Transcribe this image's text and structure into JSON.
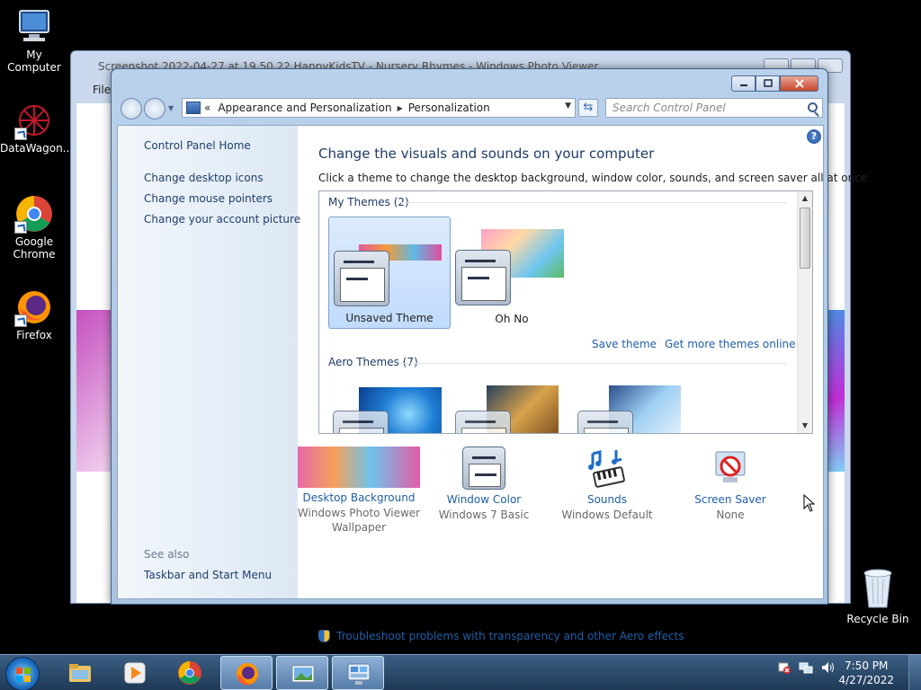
{
  "desktop": {
    "icons": [
      {
        "label": "My Computer",
        "icon": "computer-icon"
      },
      {
        "label": "DataWagon...",
        "icon": "datawagon-icon"
      },
      {
        "label": "Google Chrome",
        "icon": "chrome-icon"
      },
      {
        "label": "Firefox",
        "icon": "firefox-icon"
      }
    ],
    "recycle_bin": "Recycle Bin"
  },
  "photo_viewer": {
    "title": "Screenshot 2022-04-27 at 19.50.22 HappyKidsTV - Nursery Rhymes - Windows Photo Viewer",
    "menu_file": "File"
  },
  "control_panel": {
    "address": {
      "root_chevron": "«",
      "crumb1": "Appearance and Personalization",
      "arrow": "▶",
      "crumb2": "Personalization"
    },
    "search_placeholder": "Search Control Panel",
    "left_pane": {
      "home": "Control Panel Home",
      "links": [
        "Change desktop icons",
        "Change mouse pointers",
        "Change your account picture"
      ],
      "see_also": "See also",
      "see_also_link": "Taskbar and Start Menu"
    },
    "heading": "Change the visuals and sounds on your computer",
    "description": "Click a theme to change the desktop background, window color, sounds, and screen saver all at once.",
    "my_themes_header": "My Themes (2)",
    "my_themes": [
      {
        "label": "Unsaved Theme",
        "selected": true
      },
      {
        "label": "Oh No",
        "selected": false
      }
    ],
    "save_theme": "Save theme",
    "get_more": "Get more themes online",
    "aero_header": "Aero Themes (7)",
    "bottom_items": [
      {
        "link": "Desktop Background",
        "sub": "Windows Photo Viewer Wallpaper",
        "icon": "desktop-background-icon"
      },
      {
        "link": "Window Color",
        "sub": "Windows 7 Basic",
        "icon": "window-color-icon"
      },
      {
        "link": "Sounds",
        "sub": "Windows Default",
        "icon": "sounds-icon"
      },
      {
        "link": "Screen Saver",
        "sub": "None",
        "icon": "screen-saver-icon"
      }
    ],
    "troubleshoot": "Troubleshoot problems with transparency and other Aero effects",
    "help": "?"
  },
  "taskbar": {
    "time": "7:50 PM",
    "date": "4/27/2022",
    "pinned": [
      "explorer-icon",
      "media-player-icon",
      "chrome-icon",
      "firefox-icon",
      "photo-viewer-icon",
      "control-panel-icon"
    ]
  },
  "colors": {
    "link": "#1e5fa8",
    "heading": "#1e3a6a",
    "selection": "#c1dbfc",
    "taskbar": "#1f3957"
  }
}
